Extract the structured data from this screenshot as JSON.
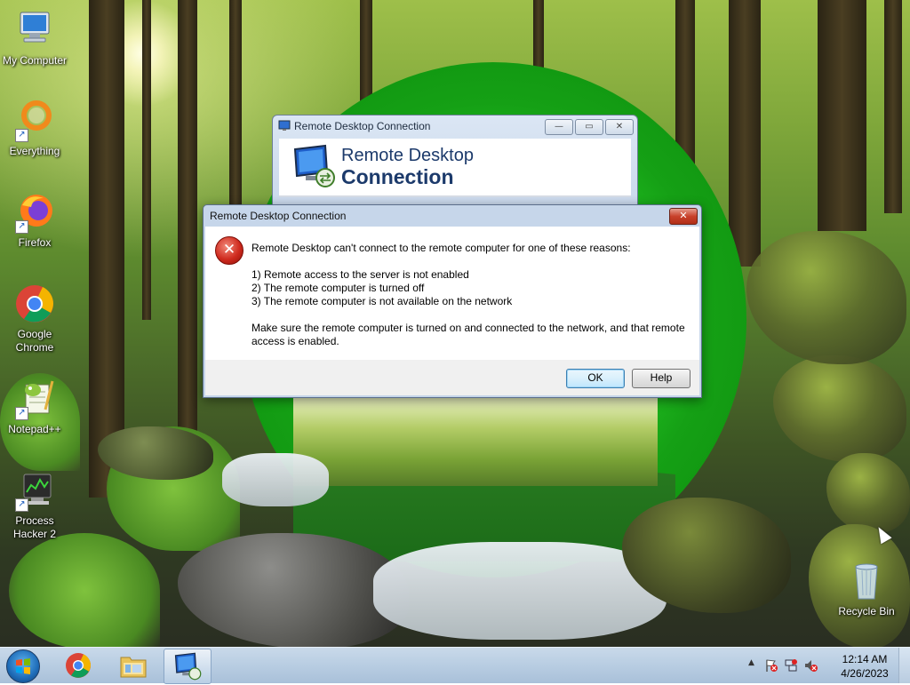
{
  "desktop": {
    "icons": [
      {
        "label": "My Computer",
        "icon": "computer-icon"
      },
      {
        "label": "Everything",
        "icon": "everything-search-icon"
      },
      {
        "label": "Firefox",
        "icon": "firefox-icon"
      },
      {
        "label": "Google Chrome",
        "icon": "chrome-icon"
      },
      {
        "label": "Notepad++",
        "icon": "notepad-plus-plus-icon"
      },
      {
        "label": "Process Hacker 2",
        "icon": "process-hacker-icon"
      },
      {
        "label": "Recycle Bin",
        "icon": "recycle-bin-icon"
      }
    ]
  },
  "rdc_window": {
    "title": "Remote Desktop Connection",
    "banner_line1": "Remote Desktop",
    "banner_line2": "Connection",
    "minimize": "—",
    "maximize": "▭",
    "close": "✕"
  },
  "error_dialog": {
    "title": "Remote Desktop Connection",
    "close": "✕",
    "intro": "Remote Desktop can't connect to the remote computer for one of these reasons:",
    "reasons": [
      "1) Remote access to the server is not enabled",
      "2) The remote computer is turned off",
      "3) The remote computer is not available on the network"
    ],
    "advice": "Make sure the remote computer is turned on and connected to the network, and that remote access is enabled.",
    "ok_label": "OK",
    "help_label": "Help"
  },
  "taskbar": {
    "pinned": [
      "start-orb",
      "chrome-icon",
      "file-explorer-icon",
      "remote-desktop-icon"
    ],
    "clock_time": "12:14 AM",
    "clock_date": "4/26/2023",
    "tray_arrow": "▲"
  },
  "colors": {
    "taskbar": "#b8cde2",
    "dialog_frame": "#c6d6ea",
    "error_red": "#cf2a1e",
    "banner_text": "#1c3a6b"
  }
}
